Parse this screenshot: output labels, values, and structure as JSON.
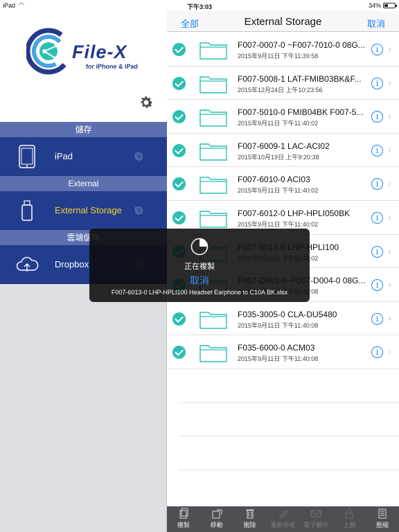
{
  "status_bar": {
    "device": "iPad",
    "time": "下午3:03",
    "battery": "34%",
    "battery_level": 0.34
  },
  "brand": {
    "name": "File-X",
    "tagline": "for iPhone & iPad",
    "colors": {
      "navy": "#263a8c",
      "teal": "#2bbfb0",
      "menu": "#233d8e",
      "active": "#f3d22b"
    }
  },
  "sidebar": {
    "sections": [
      {
        "header": "儲存",
        "item": {
          "label": "iPad",
          "icon": "ipad-icon",
          "active": false
        }
      },
      {
        "header": "External",
        "item": {
          "label": "External Storage",
          "icon": "usb-drive-icon",
          "active": true
        }
      },
      {
        "header": "雲端儲存",
        "item": {
          "label": "Dropbox",
          "icon": "cloud-upload-icon",
          "active": false
        }
      }
    ]
  },
  "navbar": {
    "left_button": "全部",
    "title": "External Storage",
    "right_button": "取消"
  },
  "files": [
    {
      "name": "F007-0007-0 ~F007-7010-0 08G...",
      "date": "2015年9月11日 下午11:39:58",
      "checked": true
    },
    {
      "name": "F007-5008-1 LAT-FMIB03BK&F...",
      "date": "2015年12月24日 上午10:23:56",
      "checked": true
    },
    {
      "name": "F007-5010-0 FMIB04BK F007-5...",
      "date": "2015年9月11日 下午11:40:02",
      "checked": true
    },
    {
      "name": "F007-6009-1 LAC-ACI02",
      "date": "2015年10月19日 上午9:20:38",
      "checked": true
    },
    {
      "name": "F007-6010-0 ACI03",
      "date": "2015年9月11日 下午11:40:02",
      "checked": true
    },
    {
      "name": "F007-6012-0 LHP-HPLI050BK",
      "date": "2015年9月11日 下午11:40:02",
      "checked": true
    },
    {
      "name": "F007-6013-0 LHP-HPLI100",
      "date": "2015年9月11日 下午11:40:02",
      "checked": true
    },
    {
      "name": "F007-D001-0~F007-D004-0 08G...",
      "date": "2015年9月11日 下午11:40:08",
      "checked": true
    },
    {
      "name": "F035-3005-0 CLA-DU5480",
      "date": "2015年9月11日 下午11:40:08",
      "checked": true
    },
    {
      "name": "F035-6000-0 ACM03",
      "date": "2015年9月11日 下午11:40:08",
      "checked": true
    }
  ],
  "toolbar": [
    {
      "label": "複製",
      "icon": "copy-icon",
      "enabled": true
    },
    {
      "label": "移動",
      "icon": "move-icon",
      "enabled": true
    },
    {
      "label": "刪除",
      "icon": "trash-icon",
      "enabled": true
    },
    {
      "label": "重新命名",
      "icon": "rename-icon",
      "enabled": false
    },
    {
      "label": "電子郵件",
      "icon": "mail-icon",
      "enabled": false
    },
    {
      "label": "上鎖",
      "icon": "lock-icon",
      "enabled": false
    },
    {
      "label": "壓縮",
      "icon": "compress-icon",
      "enabled": true
    }
  ],
  "copy_dialog": {
    "status": "正在複製",
    "cancel": "取消",
    "filename": "F007-6013-0 LHP-HPLI100 Headset Earphone to C10A BK.xlsx",
    "progress": 0.25
  }
}
